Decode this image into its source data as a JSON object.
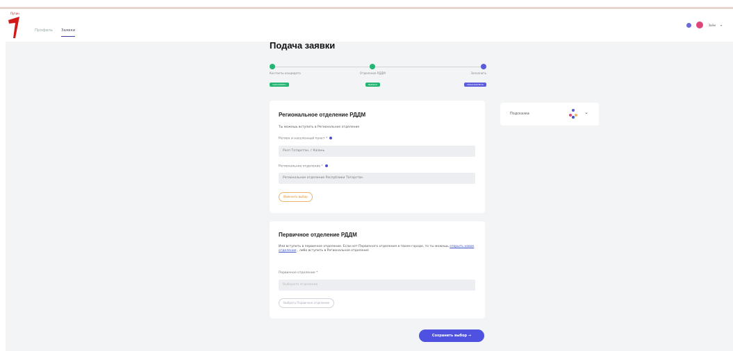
{
  "header": {
    "logo_text": "Путин",
    "nav": [
      {
        "label": "Профиль"
      },
      {
        "label": "Заявки"
      }
    ],
    "user_name": "Заём"
  },
  "page": {
    "title": "Подача заявки"
  },
  "steps": [
    {
      "label": "Контакты кандидата",
      "badge": "ЗАПОЛНЕНО",
      "color": "#22b573"
    },
    {
      "label": "Отделение РДДМ",
      "badge": "ВЫБРАН",
      "color": "#22b573"
    },
    {
      "label": "Заполнить",
      "badge": "НЕЗАПОЛНЕНО",
      "color": "#5b5bdc"
    }
  ],
  "regional": {
    "title": "Региональное отделение РДДМ",
    "description": "Ты можешь вступить в Региональное отделение",
    "region_label": "Регион и населенный пункт *",
    "region_value": "Респ Татарстан, г Казань",
    "dept_label": "Региональное отделение *",
    "dept_value": "Региональное отделение Республики Татарстан",
    "change_button": "Изменить выбор"
  },
  "primary": {
    "title": "Первичное отделение РДДМ",
    "desc_part1": "Или вступить в первичное отделение. Если нет Первичного отделения в твоем городе, то ты можешь ",
    "desc_link": "открыть новое отделение",
    "desc_part2": " , либо вступить в Региональное отделение",
    "dept_label": "Первичное отделение *",
    "dept_placeholder": "Выберите отделение",
    "select_button": "Выбрать Первичное отделение"
  },
  "hint": {
    "label": "Подсказка"
  },
  "save_button": "Сохранить выбор  →",
  "colors": {
    "accent": "#4f52e0",
    "success": "#22b573",
    "orange": "#f0b26b",
    "logo_red": "#d11a1a"
  }
}
